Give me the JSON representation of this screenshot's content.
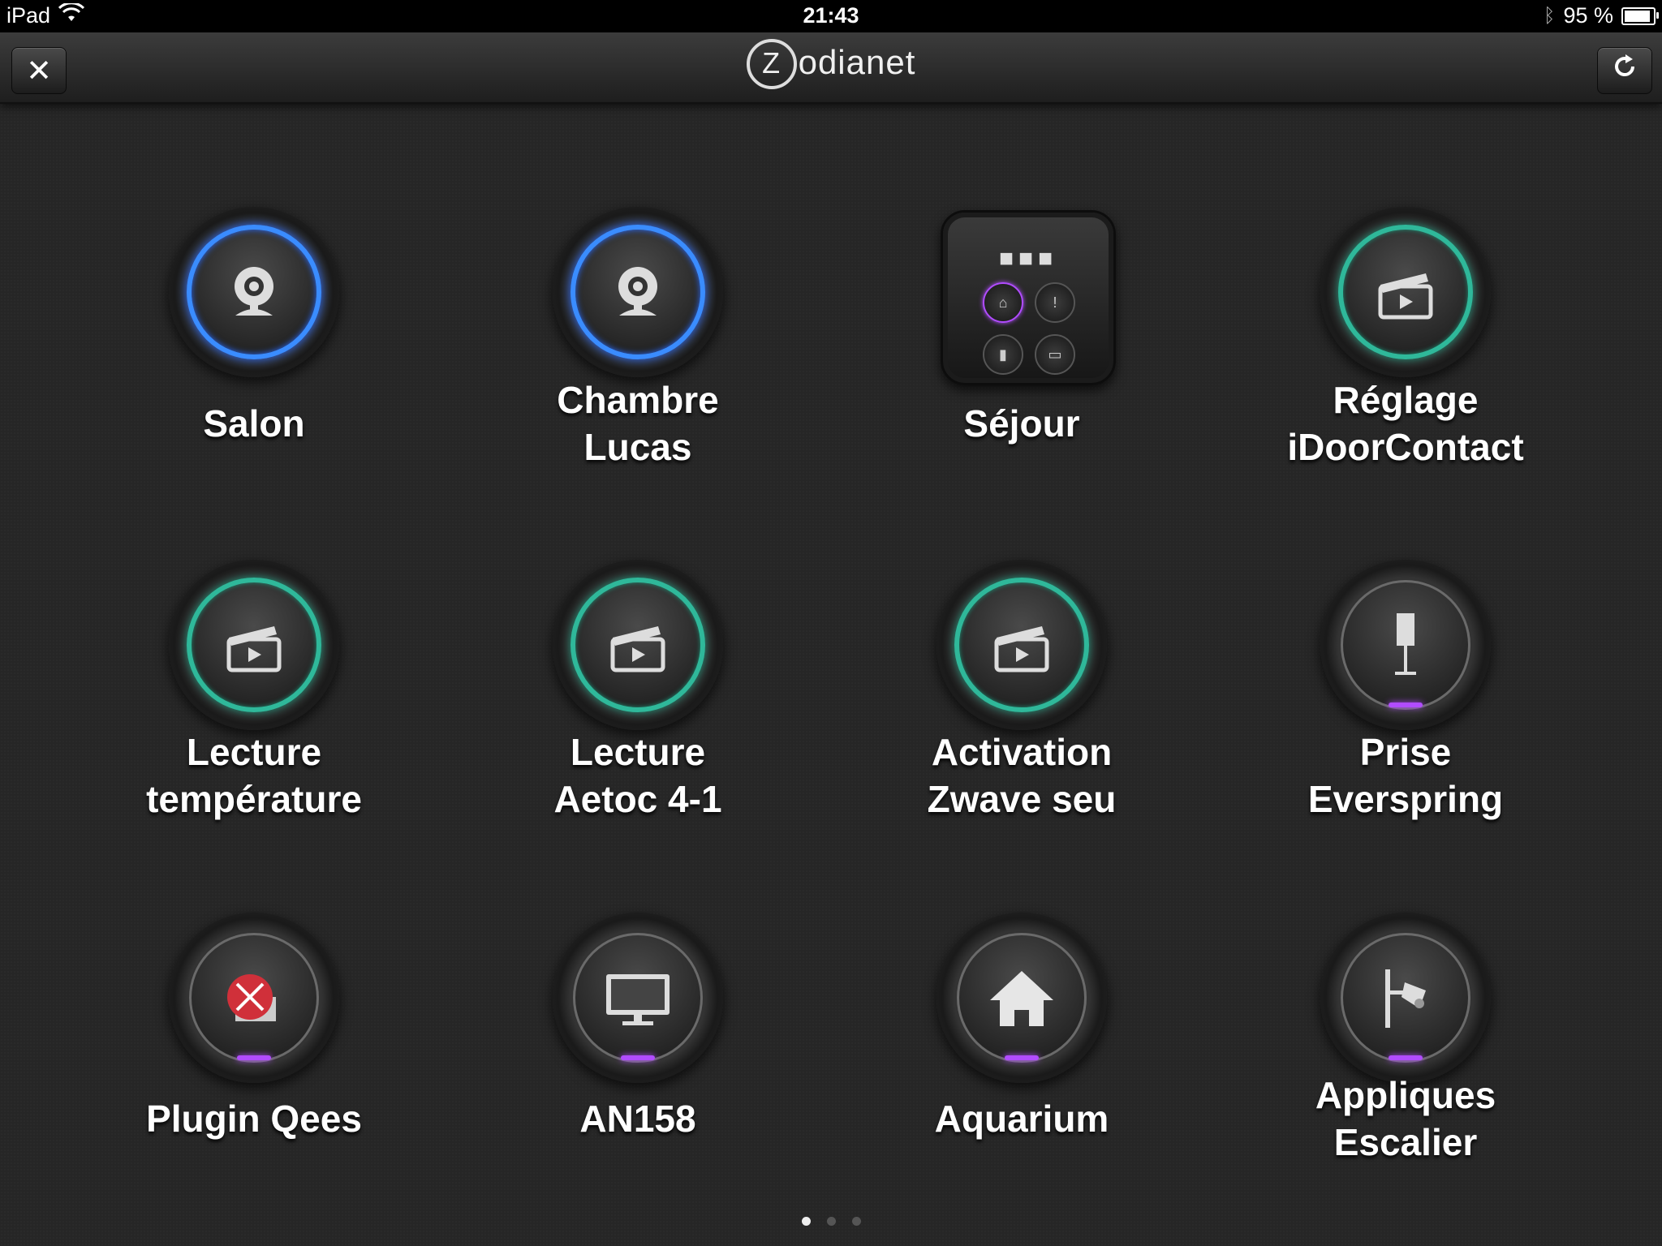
{
  "status_bar": {
    "device": "iPad",
    "time": "21:43",
    "battery": "95 %"
  },
  "nav": {
    "logo_letter": "Z",
    "logo_text": "odianet"
  },
  "tiles": [
    {
      "label_line1": "Salon",
      "label_line2": "",
      "icon": "webcam-icon",
      "style": "blue"
    },
    {
      "label_line1": "Chambre",
      "label_line2": "Lucas",
      "icon": "webcam-icon",
      "style": "blue"
    },
    {
      "label_line1": "Séjour",
      "label_line2": "",
      "icon": "folder-icon",
      "style": "folder"
    },
    {
      "label_line1": "Réglage",
      "label_line2": "iDoorContact",
      "icon": "scene-clapper-icon",
      "style": "teal"
    },
    {
      "label_line1": "Lecture",
      "label_line2": "température",
      "icon": "scene-clapper-icon",
      "style": "teal"
    },
    {
      "label_line1": "Lecture",
      "label_line2": "Aetoc 4-1",
      "icon": "scene-clapper-icon",
      "style": "teal"
    },
    {
      "label_line1": "Activation",
      "label_line2": "Zwave seu",
      "icon": "scene-clapper-icon",
      "style": "teal"
    },
    {
      "label_line1": "Prise",
      "label_line2": "Everspring",
      "icon": "floor-lamp-icon",
      "style": "purple"
    },
    {
      "label_line1": "Plugin Qees",
      "label_line2": "",
      "icon": "error-icon",
      "style": "purple"
    },
    {
      "label_line1": "AN158",
      "label_line2": "",
      "icon": "monitor-icon",
      "style": "purple"
    },
    {
      "label_line1": "Aquarium",
      "label_line2": "",
      "icon": "house-icon",
      "style": "purple"
    },
    {
      "label_line1": "Appliques",
      "label_line2": "Escalier",
      "icon": "wall-lamp-icon",
      "style": "purple"
    }
  ],
  "pager": {
    "pages": 3,
    "current": 1
  },
  "colors": {
    "blue_ring": "#3a8cff",
    "teal_ring": "#2fb89a",
    "purple_indicator": "#b14cff"
  }
}
